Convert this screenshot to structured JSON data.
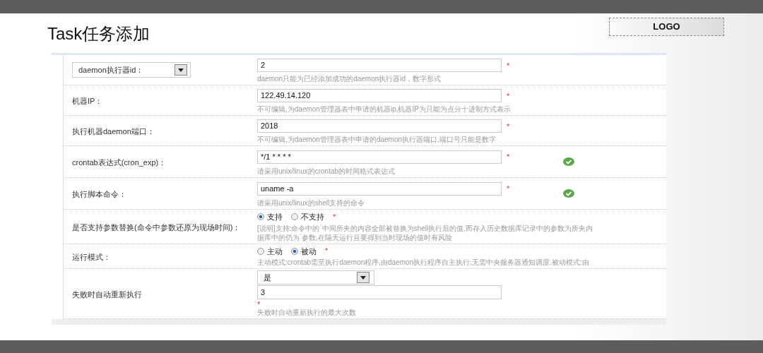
{
  "slide": {
    "title": "Task任务添加",
    "logo": "LOGO"
  },
  "form": {
    "rows": [
      {
        "kind": "text",
        "label": "daemon执行器id：",
        "label_dropdown": true,
        "value": "2",
        "required_mark": "*",
        "valid": false,
        "hint": [
          "daemon只能为已经添加成功的daemon执行器id，数字形式"
        ]
      },
      {
        "kind": "text",
        "label": "机器IP：",
        "label_dropdown": false,
        "value": "122.49.14.120",
        "required_mark": "*",
        "valid": false,
        "hint": [
          "不可编辑,为daemon管理器表中申请的机器ip,机器IP为只能为点分十进制方式表示"
        ]
      },
      {
        "kind": "text",
        "label": "执行机器daemon端口：",
        "label_dropdown": false,
        "value": "2018",
        "required_mark": "*",
        "valid": false,
        "hint": [
          "不可编辑,为daemon管理器表中申请的daemon执行器端口,端口号只能是数字"
        ]
      },
      {
        "kind": "text",
        "label": "crontab表达式(cron_exp)：",
        "label_dropdown": false,
        "value": "*/1 * * * *",
        "required_mark": "*",
        "valid": true,
        "hint": [
          "请采用unix/linux的crontab的时间格式表达式"
        ]
      },
      {
        "kind": "text",
        "label": "执行脚本命令：",
        "label_dropdown": false,
        "value": "uname -a",
        "required_mark": "*",
        "valid": true,
        "hint": [
          "请采用unix/linux的shell支持的命令"
        ]
      },
      {
        "kind": "radio",
        "label": "是否支持参数替换(命令中参数还原为现场时间)：",
        "required_mark": "*",
        "options": [
          {
            "label": "支持",
            "selected": true
          },
          {
            "label": "不支持",
            "selected": false
          }
        ],
        "hint": [
          "[说明]支持:命令中的`中间所夹的内容全部被替换为shell执行后的值,而存入历史数据库记录中的参数为所夹内",
          "据库中的仍为`参数,在隔天运行且要得到当时现场的值时有风险"
        ]
      },
      {
        "kind": "radio",
        "label": "运行模式：",
        "required_mark": "*",
        "options": [
          {
            "label": "主动",
            "selected": false
          },
          {
            "label": "被动",
            "selected": true
          }
        ],
        "hint": [
          "主动模式:crontab需至执行daemon程序,由daemon执行程序自主执行,无需中央服务器通知调度.被动模式:由"
        ]
      },
      {
        "kind": "select_field",
        "label": "失败时自动重新执行",
        "select": "是",
        "value": "3",
        "required_mark": "*",
        "hint": [
          "失败时自动重新执行的最大次数"
        ]
      }
    ]
  }
}
